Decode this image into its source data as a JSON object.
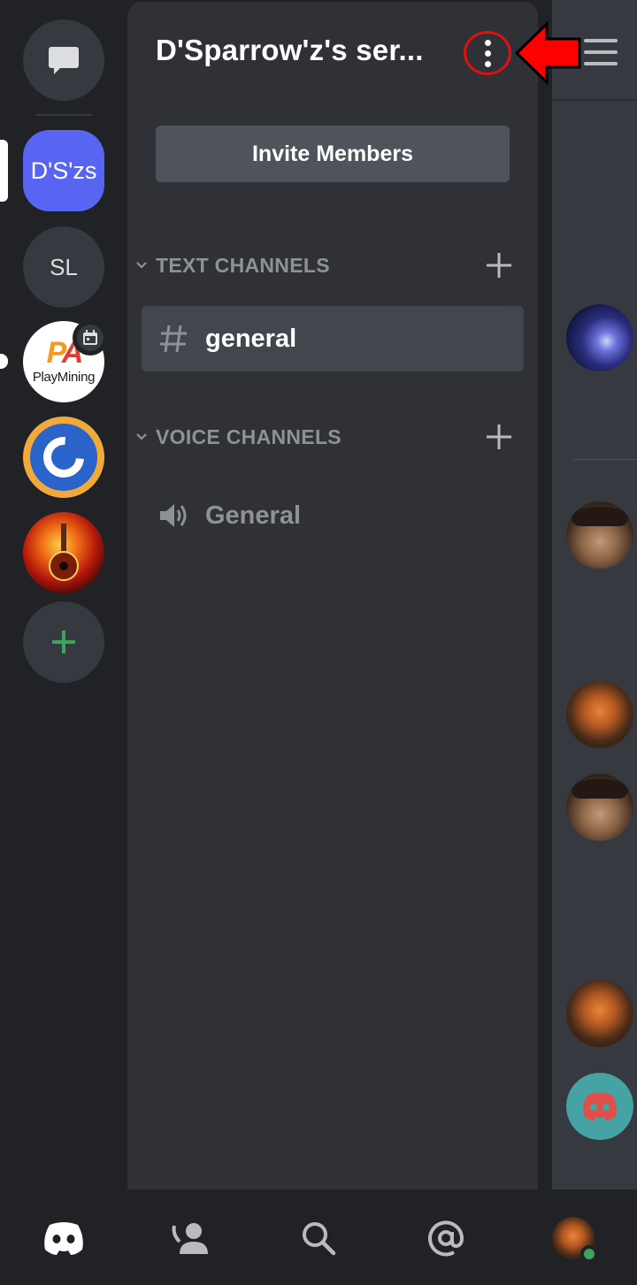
{
  "server_rail": {
    "active_server_initials": "D'S'zs",
    "servers": [
      {
        "initials": "SL"
      },
      {
        "name": "PlayMining",
        "logo_text": "PlayMining"
      }
    ]
  },
  "panel": {
    "server_title": "D'Sparrow'z's ser...",
    "invite_label": "Invite Members",
    "categories": [
      {
        "label": "TEXT CHANNELS",
        "channels": [
          {
            "name": "general",
            "type": "text",
            "selected": true
          }
        ]
      },
      {
        "label": "VOICE CHANNELS",
        "channels": [
          {
            "name": "General",
            "type": "voice",
            "selected": false
          }
        ]
      }
    ]
  },
  "right_panel": {
    "avatars": [
      "lightning",
      "pirate",
      "lion",
      "pirate",
      "lion",
      "discord"
    ]
  },
  "bottom_nav": {
    "tabs": [
      "home-icon",
      "friends-icon",
      "search-icon",
      "mentions-icon",
      "profile-avatar"
    ]
  },
  "colors": {
    "accent": "#5865f2",
    "highlight_ring": "#e01010",
    "arrow": "#ff0000",
    "online": "#3ba55d"
  }
}
